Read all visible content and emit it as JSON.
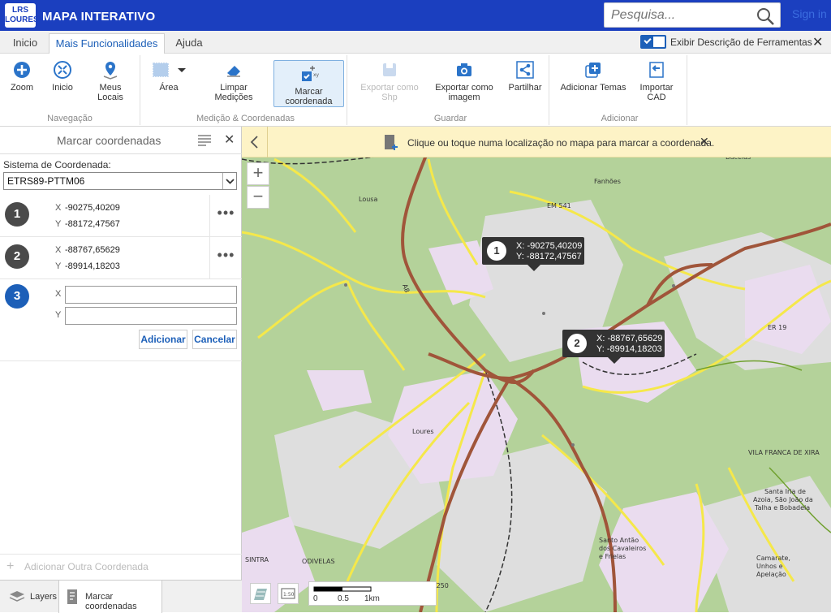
{
  "header": {
    "logo_text": "LRS LOURES",
    "title": "MAPA INTERATIVO",
    "search_placeholder": "Pesquisa...",
    "signin_label": "Sign in"
  },
  "tabs": [
    {
      "label": "Inicio",
      "active": false
    },
    {
      "label": "Mais Funcionalidades",
      "active": true
    },
    {
      "label": "Ajuda",
      "active": false
    }
  ],
  "description_toggle": {
    "label": "Exibir Descrição de Ferramentas",
    "checked": true
  },
  "ribbon": {
    "navegacao": {
      "name": "Navegação",
      "zoom": "Zoom",
      "inicio": "Inicio",
      "meus_locais": "Meus Locais"
    },
    "medicao": {
      "name": "Medição & Coordenadas",
      "area": "Área",
      "limpar": "Limpar Medições",
      "marcar_line1": "Marcar",
      "marcar_line2": "coordenada"
    },
    "guardar": {
      "name": "Guardar",
      "shp_line1": "Exportar como",
      "shp_line2": "Shp",
      "img_line1": "Exportar como",
      "img_line2": "imagem",
      "partilhar": "Partilhar"
    },
    "adicionar": {
      "name": "Adicionar",
      "temas": "Adicionar Temas",
      "cad": "Importar CAD"
    }
  },
  "panel": {
    "title": "Marcar coordenadas",
    "crs_label": "Sistema de Coordenada:",
    "crs_value": "ETRS89-PTTM06",
    "coords": [
      {
        "num": "1",
        "x": "-90275,40209",
        "y": "-88172,47567"
      },
      {
        "num": "2",
        "x": "-88767,65629",
        "y": "-89914,18203"
      }
    ],
    "new_coord": {
      "num": "3",
      "x_label": "X",
      "y_label": "Y",
      "x_value": "",
      "y_value": ""
    },
    "axis_x": "X",
    "axis_y": "Y",
    "add_button": "Adicionar",
    "cancel_button": "Cancelar",
    "add_other": "Adicionar Outra Coordenada",
    "bottom_tabs": {
      "layers": "Layers",
      "marcar": "Marcar coordenadas"
    }
  },
  "map": {
    "info_message": "Clique ou toque numa localização no mapa para marcar a coordenada.",
    "popups": [
      {
        "num": "1",
        "x_text": "X: -90275,40209",
        "y_text": "Y: -88172,47567"
      },
      {
        "num": "2",
        "x_text": "X: -88767,65629",
        "y_text": "Y: -89914,18203"
      }
    ],
    "scale_labels": {
      "s0": "0",
      "s1": "0.5",
      "s2": "1km"
    },
    "place_labels": {
      "lousa": "Lousa",
      "fanhoes": "Fanhões",
      "bucelas": "Bucelas",
      "loures": "Loures",
      "odivelas": "ODIVELAS",
      "sintra": "SINTRA",
      "vila_franca": "VILA FRANCA DE XIRA",
      "santo_antao": "Santo Antão\ndos Cavaleiros\ne Frielas",
      "camarate": "Camarate,\nUnhos e\nApelação",
      "santa_iria": "Santa Iria de\nAzoia, São João da\nTalha e Bobadela",
      "road_a8": "A8",
      "road_em541": "EM 541",
      "road_er19": "ER 19",
      "road_en250": "EN 250"
    },
    "colors": {
      "green": "#b4d29a",
      "light_gray": "#dedede",
      "pink": "#eadcef",
      "road": "#a0553a",
      "yellow": "#f5e84a"
    }
  }
}
